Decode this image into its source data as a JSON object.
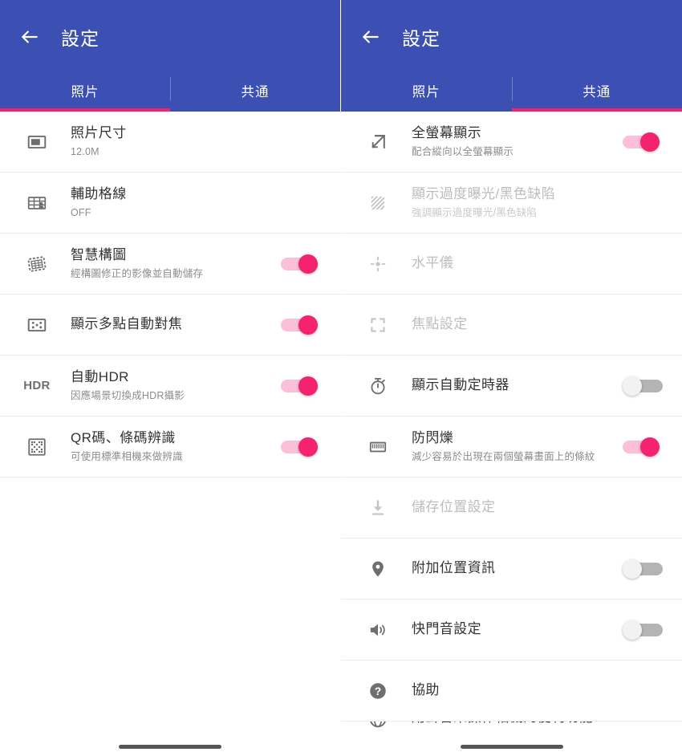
{
  "theme": {
    "appbar_blue": "#3C50B4",
    "accent_pink": "#F5236F",
    "toggle_on_track": "#FBC0D8",
    "toggle_off_track": "#B4B4B4",
    "title_color": "#333333",
    "subtitle_color": "#8C8C8C",
    "disabled_color": "#BDBDBD"
  },
  "panels": [
    {
      "id": "photo-settings",
      "appbar": {
        "back_icon": "arrow-left-icon",
        "title": "設定"
      },
      "tabs": [
        {
          "label": "照片",
          "active": true
        },
        {
          "label": "共通",
          "active": false
        }
      ],
      "active_tab_index": 0,
      "rows": [
        {
          "icon": "photo-size-icon",
          "title": "照片尺寸",
          "subtitle": "12.0M",
          "toggle": null,
          "disabled": false
        },
        {
          "icon": "grid-lines-icon",
          "title": "輔助格線",
          "subtitle": "OFF",
          "toggle": null,
          "disabled": false
        },
        {
          "icon": "smart-composition-icon",
          "title": "智慧構圖",
          "subtitle": "經構圖修正的影像並自動儲存",
          "toggle": "on",
          "disabled": false
        },
        {
          "icon": "multi-af-icon",
          "title": "顯示多點自動對焦",
          "subtitle": null,
          "toggle": "on",
          "disabled": false
        },
        {
          "icon": "hdr-text-icon",
          "icon_text": "HDR",
          "title": "自動HDR",
          "subtitle": "因應場景切換成HDR攝影",
          "toggle": "on",
          "disabled": false
        },
        {
          "icon": "qr-code-icon",
          "title": "QR碼、條碼辨識",
          "subtitle": "可使用標準相機來做辨識",
          "toggle": "on",
          "disabled": false
        }
      ]
    },
    {
      "id": "common-settings",
      "appbar": {
        "back_icon": "arrow-left-icon",
        "title": "設定"
      },
      "tabs": [
        {
          "label": "照片",
          "active": false
        },
        {
          "label": "共通",
          "active": true
        }
      ],
      "active_tab_index": 1,
      "rows": [
        {
          "icon": "fullscreen-arrow-icon",
          "title": "全螢幕顯示",
          "subtitle": "配合縱向以全螢幕顯示",
          "toggle": "on",
          "disabled": false
        },
        {
          "icon": "zebra-stripes-icon",
          "title": "顯示過度曝光/黑色缺陷",
          "subtitle": "強調顯示過度曝光/黑色缺陷",
          "toggle": null,
          "disabled": true
        },
        {
          "icon": "level-gauge-icon",
          "title": "水平儀",
          "subtitle": null,
          "toggle": null,
          "disabled": true
        },
        {
          "icon": "focus-brackets-icon",
          "title": "焦點設定",
          "subtitle": null,
          "toggle": null,
          "disabled": true
        },
        {
          "icon": "timer-icon",
          "title": "顯示自動定時器",
          "subtitle": null,
          "toggle": "off",
          "disabled": false
        },
        {
          "icon": "anti-flicker-icon",
          "title": "防閃爍",
          "subtitle": "減少容易於出現在兩個螢幕畫面上的條紋",
          "toggle": "on",
          "disabled": false
        },
        {
          "icon": "save-location-icon",
          "title": "儲存位置設定",
          "subtitle": null,
          "toggle": null,
          "disabled": true
        },
        {
          "icon": "location-pin-icon",
          "title": "附加位置資訊",
          "subtitle": null,
          "toggle": "off",
          "disabled": false
        },
        {
          "icon": "speaker-icon",
          "title": "快門音設定",
          "subtitle": null,
          "toggle": "off",
          "disabled": false
        },
        {
          "icon": "help-circle-icon",
          "title": "協助",
          "subtitle": null,
          "toggle": null,
          "disabled": false
        },
        {
          "icon": "voice-globe-icon",
          "title": "用聲音來操作相機的便利功能",
          "subtitle": null,
          "toggle": null,
          "disabled": false,
          "cut_off": true
        }
      ]
    }
  ]
}
